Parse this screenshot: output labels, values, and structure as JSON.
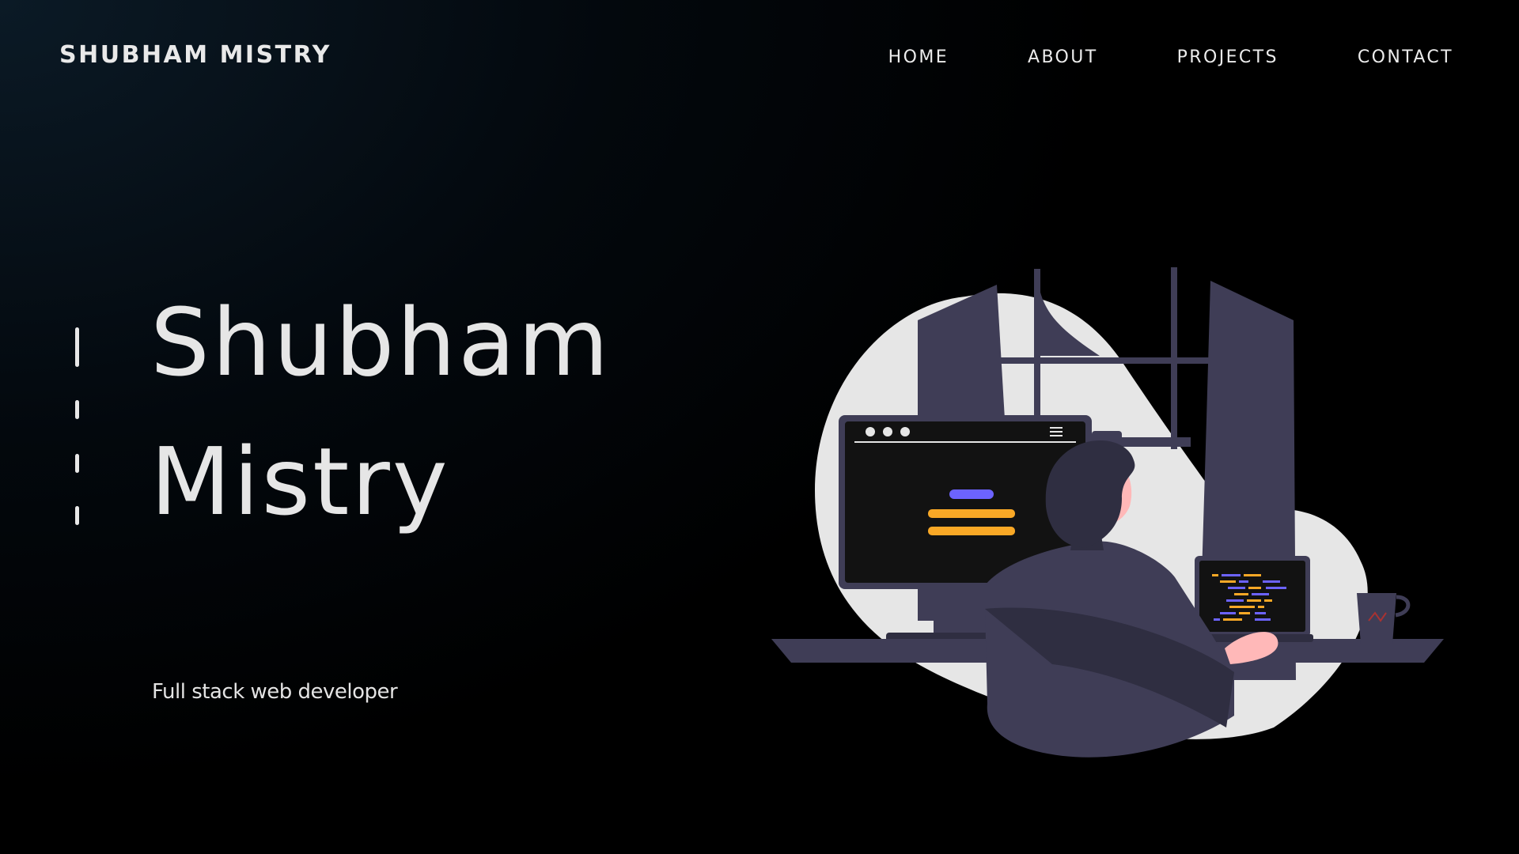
{
  "header": {
    "brand": "SHUBHAM MISTRY",
    "nav": [
      {
        "label": "HOME"
      },
      {
        "label": "ABOUT"
      },
      {
        "label": "PROJECTS"
      },
      {
        "label": "CONTACT"
      }
    ]
  },
  "hero": {
    "first_name": "Shubham",
    "last_name": "Mistry",
    "tagline": "Full stack web developer"
  },
  "colors": {
    "background": "#02070b",
    "text": "#e6e6e6",
    "accent_purple": "#6c63ff",
    "accent_orange": "#f9a826",
    "illustration_dark": "#3f3d56",
    "illustration_light": "#e6e6e6"
  },
  "illustration": {
    "icon": "developer-at-desk-illustration"
  }
}
